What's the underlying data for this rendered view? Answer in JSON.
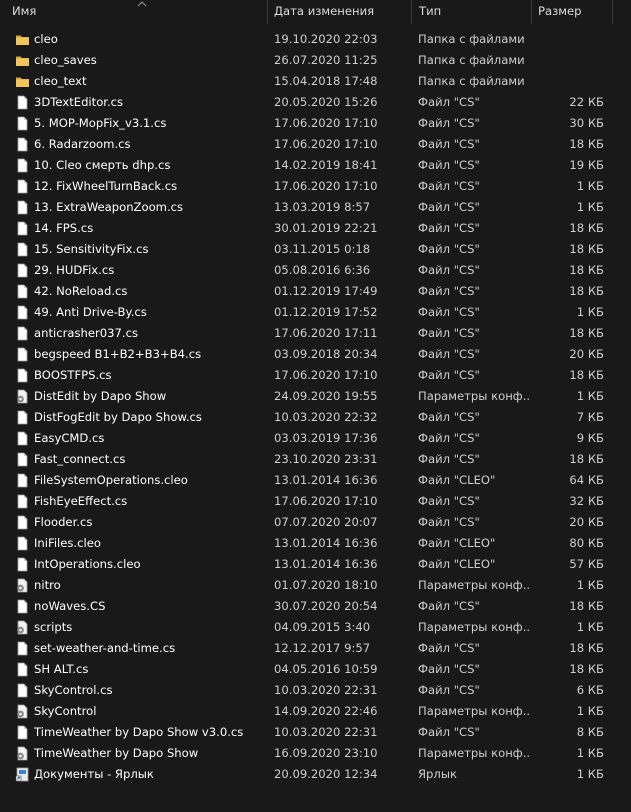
{
  "columns": {
    "name": "Имя",
    "date": "Дата изменения",
    "type": "Тип",
    "size": "Размер"
  },
  "icon_names": {
    "folder": "folder-icon",
    "file": "file-icon",
    "settings": "settings-file-icon",
    "shortcut": "shortcut-icon"
  },
  "files": [
    {
      "icon": "folder",
      "name": "cleo",
      "date": "19.10.2020 22:03",
      "type": "Папка с файлами",
      "size": ""
    },
    {
      "icon": "folder",
      "name": "cleo_saves",
      "date": "26.07.2020 11:25",
      "type": "Папка с файлами",
      "size": ""
    },
    {
      "icon": "folder",
      "name": "cleo_text",
      "date": "15.04.2018 17:48",
      "type": "Папка с файлами",
      "size": ""
    },
    {
      "icon": "file",
      "name": "3DTextEditor.cs",
      "date": "20.05.2020 15:26",
      "type": "Файл \"CS\"",
      "size": "22 КБ"
    },
    {
      "icon": "file",
      "name": "5. MOP-MopFix_v3.1.cs",
      "date": "17.06.2020 17:10",
      "type": "Файл \"CS\"",
      "size": "30 КБ"
    },
    {
      "icon": "file",
      "name": "6. Radarzoom.cs",
      "date": "17.06.2020 17:10",
      "type": "Файл \"CS\"",
      "size": "18 КБ"
    },
    {
      "icon": "file",
      "name": "10. Cleo смерть dhp.cs",
      "date": "14.02.2019 18:41",
      "type": "Файл \"CS\"",
      "size": "19 КБ"
    },
    {
      "icon": "file",
      "name": "12. FixWheelTurnBack.cs",
      "date": "17.06.2020 17:10",
      "type": "Файл \"CS\"",
      "size": "1 КБ"
    },
    {
      "icon": "file",
      "name": "13. ExtraWeaponZoom.cs",
      "date": "13.03.2019 8:57",
      "type": "Файл \"CS\"",
      "size": "1 КБ"
    },
    {
      "icon": "file",
      "name": "14. FPS.cs",
      "date": "30.01.2019 22:21",
      "type": "Файл \"CS\"",
      "size": "18 КБ"
    },
    {
      "icon": "file",
      "name": "15. SensitivityFix.cs",
      "date": "03.11.2015 0:18",
      "type": "Файл \"CS\"",
      "size": "18 КБ"
    },
    {
      "icon": "file",
      "name": "29. HUDFix.cs",
      "date": "05.08.2016 6:36",
      "type": "Файл \"CS\"",
      "size": "18 КБ"
    },
    {
      "icon": "file",
      "name": "42. NoReload.cs",
      "date": "01.12.2019 17:49",
      "type": "Файл \"CS\"",
      "size": "18 КБ"
    },
    {
      "icon": "file",
      "name": "49. Anti Drive-By.cs",
      "date": "01.12.2019 17:52",
      "type": "Файл \"CS\"",
      "size": "1 КБ"
    },
    {
      "icon": "file",
      "name": "anticrasher037.cs",
      "date": "17.06.2020 17:11",
      "type": "Файл \"CS\"",
      "size": "18 КБ"
    },
    {
      "icon": "file",
      "name": "begspeed B1+B2+B3+B4.cs",
      "date": "03.09.2018 20:34",
      "type": "Файл \"CS\"",
      "size": "20 КБ"
    },
    {
      "icon": "file",
      "name": "BOOSTFPS.cs",
      "date": "17.06.2020 17:10",
      "type": "Файл \"CS\"",
      "size": "18 КБ"
    },
    {
      "icon": "settings",
      "name": "DistEdit by Dapo Show",
      "date": "24.09.2020 19:55",
      "type": "Параметры конф...",
      "size": "1 КБ"
    },
    {
      "icon": "file",
      "name": "DistFogEdit by Dapo Show.cs",
      "date": "10.03.2020 22:32",
      "type": "Файл \"CS\"",
      "size": "7 КБ"
    },
    {
      "icon": "file",
      "name": "EasyCMD.cs",
      "date": "03.03.2019 17:36",
      "type": "Файл \"CS\"",
      "size": "9 КБ"
    },
    {
      "icon": "file",
      "name": "Fast_connect.cs",
      "date": "23.10.2020 23:31",
      "type": "Файл \"CS\"",
      "size": "18 КБ"
    },
    {
      "icon": "file",
      "name": "FileSystemOperations.cleo",
      "date": "13.01.2014 16:36",
      "type": "Файл \"CLEO\"",
      "size": "64 КБ"
    },
    {
      "icon": "file",
      "name": "FishEyeEffect.cs",
      "date": "17.06.2020 17:10",
      "type": "Файл \"CS\"",
      "size": "32 КБ"
    },
    {
      "icon": "file",
      "name": "Flooder.cs",
      "date": "07.07.2020 20:07",
      "type": "Файл \"CS\"",
      "size": "20 КБ"
    },
    {
      "icon": "file",
      "name": "IniFiles.cleo",
      "date": "13.01.2014 16:36",
      "type": "Файл \"CLEO\"",
      "size": "80 КБ"
    },
    {
      "icon": "file",
      "name": "IntOperations.cleo",
      "date": "13.01.2014 16:36",
      "type": "Файл \"CLEO\"",
      "size": "57 КБ"
    },
    {
      "icon": "settings",
      "name": "nitro",
      "date": "01.07.2020 18:10",
      "type": "Параметры конф...",
      "size": "1 КБ"
    },
    {
      "icon": "file",
      "name": "noWaves.CS",
      "date": "30.07.2020 20:54",
      "type": "Файл \"CS\"",
      "size": "18 КБ"
    },
    {
      "icon": "settings",
      "name": "scripts",
      "date": "04.09.2015 3:40",
      "type": "Параметры конф...",
      "size": "1 КБ"
    },
    {
      "icon": "file",
      "name": "set-weather-and-time.cs",
      "date": "12.12.2017 9:57",
      "type": "Файл \"CS\"",
      "size": "18 КБ"
    },
    {
      "icon": "file",
      "name": "SH ALT.cs",
      "date": "04.05.2016 10:59",
      "type": "Файл \"CS\"",
      "size": "18 КБ"
    },
    {
      "icon": "file",
      "name": "SkyControl.cs",
      "date": "10.03.2020 22:31",
      "type": "Файл \"CS\"",
      "size": "6 КБ"
    },
    {
      "icon": "settings",
      "name": "SkyControl",
      "date": "14.09.2020 22:46",
      "type": "Параметры конф...",
      "size": "1 КБ"
    },
    {
      "icon": "file",
      "name": "TimeWeather by Dapo Show v3.0.cs",
      "date": "10.03.2020 22:31",
      "type": "Файл \"CS\"",
      "size": "8 КБ"
    },
    {
      "icon": "settings",
      "name": "TimeWeather by Dapo Show",
      "date": "16.09.2020 23:10",
      "type": "Параметры конф...",
      "size": "1 КБ"
    },
    {
      "icon": "shortcut",
      "name": "Документы - Ярлык",
      "date": "20.09.2020 12:34",
      "type": "Ярлык",
      "size": "1 КБ"
    }
  ]
}
